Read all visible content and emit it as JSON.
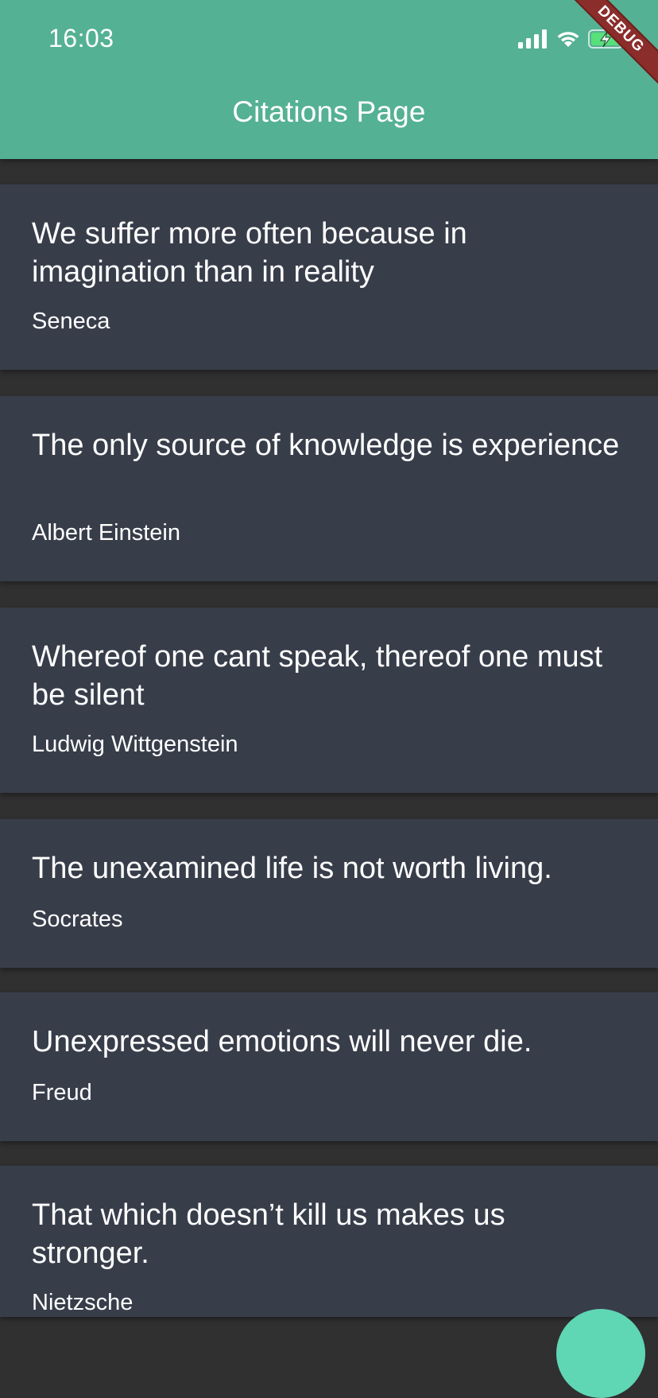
{
  "status_bar": {
    "time": "16:03",
    "icons": [
      "cellular-signal-icon",
      "wifi-icon",
      "battery-charging-icon"
    ]
  },
  "app_bar": {
    "title": "Citations Page"
  },
  "debug_banner": {
    "label": "DEBUG"
  },
  "citations": [
    {
      "quote": "We suffer more often because in imagination than in reality",
      "author": "Seneca"
    },
    {
      "quote": "The only source of knowledge is experience",
      "author": "Albert Einstein"
    },
    {
      "quote": "Whereof one cant speak, thereof one must be silent",
      "author": "Ludwig Wittgenstein"
    },
    {
      "quote": "The unexamined life is not worth living.",
      "author": "Socrates"
    },
    {
      "quote": "Unexpressed emotions will never die.",
      "author": "Freud"
    },
    {
      "quote": "That which doesn’t kill us makes us stronger.",
      "author": "Nietzsche"
    }
  ],
  "colors": {
    "app_bar": "#55b193",
    "background": "#303030",
    "card": "#383d4a",
    "fab": "#5fd6b4",
    "debug_banner": "#8a2d2b"
  }
}
